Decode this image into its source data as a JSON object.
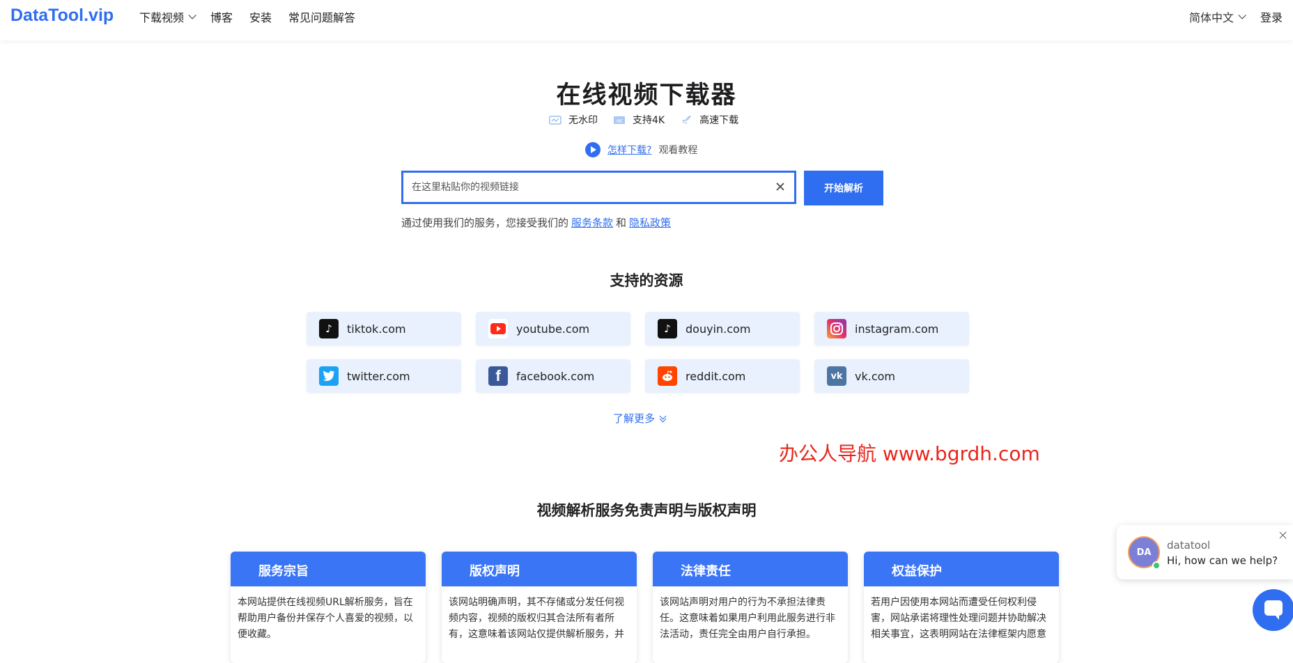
{
  "header": {
    "logo": "DataTool.vip",
    "nav": [
      {
        "label": "下载视频",
        "has_dropdown": true
      },
      {
        "label": "博客"
      },
      {
        "label": "安装"
      },
      {
        "label": "常见问题解答"
      }
    ],
    "language": "简体中文",
    "login": "登录"
  },
  "hero": {
    "title": "在线视频下载器",
    "features": [
      {
        "icon": "no-watermark-icon",
        "label": "无水印"
      },
      {
        "icon": "4k-icon",
        "label": "支持4K"
      },
      {
        "icon": "rocket-icon",
        "label": "高速下载"
      }
    ],
    "howto_link": "怎样下载?",
    "howto_text": "观看教程"
  },
  "search": {
    "placeholder": "在这里粘贴你的视频链接",
    "value": "",
    "button": "开始解析"
  },
  "terms": {
    "prefix": "通过使用我们的服务，您接受我们的",
    "terms_link": "服务条款",
    "and": "和",
    "privacy_link": "隐私政策"
  },
  "supported": {
    "title": "支持的资源",
    "sites": [
      {
        "name": "tiktok.com",
        "icon": "tiktok-icon",
        "color": "#111111",
        "glyph": "♪"
      },
      {
        "name": "youtube.com",
        "icon": "youtube-icon",
        "color": "#ff2a1a",
        "glyph": "▶"
      },
      {
        "name": "douyin.com",
        "icon": "douyin-icon",
        "color": "#111111",
        "glyph": "♪"
      },
      {
        "name": "instagram.com",
        "icon": "instagram-icon",
        "color": "#e1306c",
        "glyph": "◎"
      },
      {
        "name": "twitter.com",
        "icon": "twitter-icon",
        "color": "#1da1f2",
        "glyph": "✦"
      },
      {
        "name": "facebook.com",
        "icon": "facebook-icon",
        "color": "#3b5998",
        "glyph": "f"
      },
      {
        "name": "reddit.com",
        "icon": "reddit-icon",
        "color": "#ff4500",
        "glyph": "●"
      },
      {
        "name": "vk.com",
        "icon": "vk-icon",
        "color": "#4c75a3",
        "glyph": "vk"
      }
    ],
    "more": "了解更多"
  },
  "watermark": "办公人导航  www.bgrdh.com",
  "disclaimer": {
    "title": "视频解析服务免责声明与版权声明",
    "cards": [
      {
        "title": "服务宗旨",
        "body": "本网站提供在线视频URL解析服务，旨在帮助用户备份并保存个人喜爱的视频，以便收藏。"
      },
      {
        "title": "版权声明",
        "body": "该网站明确声明，其不存储或分发任何视频内容，视频的版权归其合法所有者所有，这意味着该网站仅提供解析服务，并"
      },
      {
        "title": "法律责任",
        "body": "该网站声明对用户的行为不承担法律责任。这意味着如果用户利用此服务进行非法活动，责任完全由用户自行承担。"
      },
      {
        "title": "权益保护",
        "body": "若用户因使用本网站而遭受任何权利侵害，网站承诺将理性处理问题并协助解决相关事宜，这表明网站在法律框架内愿意"
      }
    ]
  },
  "chat": {
    "avatar": "DA",
    "name": "datatool",
    "message": "Hi, how can we help?"
  },
  "colors": {
    "accent": "#2f6ef0",
    "card_header": "#3a75f6",
    "site_bg": "#e8f1fd",
    "watermark": "#e8261d"
  }
}
